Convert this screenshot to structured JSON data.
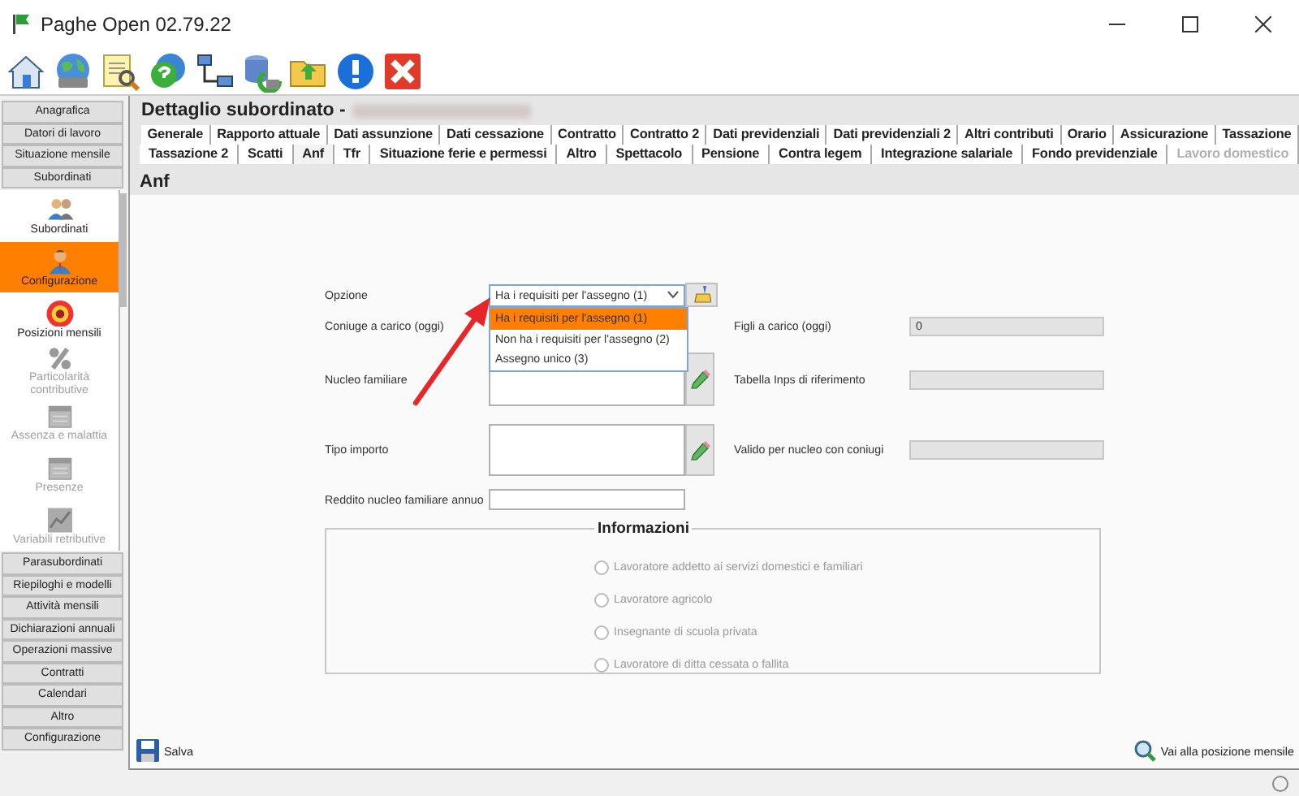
{
  "window": {
    "title": "Paghe Open 02.79.22"
  },
  "sidebar": {
    "top_items": [
      {
        "label": "Anagrafica"
      },
      {
        "label": "Datori di lavoro"
      },
      {
        "label": "Situazione mensile"
      },
      {
        "label": "Subordinati"
      }
    ],
    "items": [
      {
        "label": "Subordinati",
        "selected": false,
        "disabled": false
      },
      {
        "label": "Configurazione",
        "selected": true,
        "disabled": false
      },
      {
        "label": "Posizioni mensili",
        "selected": false,
        "disabled": false
      },
      {
        "label": "Particolarità contributive",
        "selected": false,
        "disabled": true
      },
      {
        "label": "Assenza e malattia",
        "selected": false,
        "disabled": true
      },
      {
        "label": "Presenze",
        "selected": false,
        "disabled": true
      },
      {
        "label": "Variabili retributive",
        "selected": false,
        "disabled": true
      }
    ],
    "bottom_items": [
      {
        "label": "Parasubordinati"
      },
      {
        "label": "Riepiloghi e modelli"
      },
      {
        "label": "Attività mensili"
      },
      {
        "label": "Dichiarazioni annuali"
      },
      {
        "label": "Operazioni massive"
      },
      {
        "label": "Contratti"
      },
      {
        "label": "Calendari"
      },
      {
        "label": "Altro"
      },
      {
        "label": "Configurazione"
      }
    ]
  },
  "header": {
    "title": "Dettaglio subordinato -"
  },
  "tab_rows": [
    [
      {
        "label": "Generale",
        "selected": false,
        "disabled": false
      },
      {
        "label": "Rapporto attuale",
        "selected": false,
        "disabled": false
      },
      {
        "label": "Dati assunzione",
        "selected": false,
        "disabled": false
      },
      {
        "label": "Dati cessazione",
        "selected": false,
        "disabled": false
      },
      {
        "label": "Contratto",
        "selected": false,
        "disabled": false
      },
      {
        "label": "Contratto 2",
        "selected": false,
        "disabled": false
      },
      {
        "label": "Dati previdenziali",
        "selected": false,
        "disabled": false
      },
      {
        "label": "Dati previdenziali 2",
        "selected": false,
        "disabled": false
      },
      {
        "label": "Altri contributi",
        "selected": false,
        "disabled": false
      },
      {
        "label": "Orario",
        "selected": false,
        "disabled": false
      },
      {
        "label": "Assicurazione",
        "selected": false,
        "disabled": false
      },
      {
        "label": "Tassazione",
        "selected": false,
        "disabled": false
      }
    ],
    [
      {
        "label": "Tassazione 2",
        "selected": false,
        "disabled": false
      },
      {
        "label": "Scatti",
        "selected": false,
        "disabled": false
      },
      {
        "label": "Anf",
        "selected": true,
        "disabled": false
      },
      {
        "label": "Tfr",
        "selected": false,
        "disabled": false
      },
      {
        "label": "Situazione ferie e permessi",
        "selected": false,
        "disabled": false
      },
      {
        "label": "Altro",
        "selected": false,
        "disabled": false
      },
      {
        "label": "Spettacolo",
        "selected": false,
        "disabled": false
      },
      {
        "label": "Pensione",
        "selected": false,
        "disabled": false
      },
      {
        "label": "Contra legem",
        "selected": false,
        "disabled": false
      },
      {
        "label": "Integrazione salariale",
        "selected": false,
        "disabled": false
      },
      {
        "label": "Fondo previdenziale",
        "selected": false,
        "disabled": false
      },
      {
        "label": "Lavoro domestico",
        "selected": false,
        "disabled": true
      }
    ]
  ],
  "section": {
    "title": "Anf"
  },
  "form": {
    "opzione": {
      "label": "Opzione",
      "value": "Ha i requisiti per l'assegno (1)",
      "expanded": true,
      "options": [
        {
          "label": "Ha i requisiti per l'assegno (1)",
          "selected": true
        },
        {
          "label": "Non ha i requisiti per l'assegno (2)",
          "selected": false
        },
        {
          "label": "Assegno unico (3)",
          "selected": false
        }
      ]
    },
    "coniuge": {
      "label": "Coniuge a carico (oggi)"
    },
    "nucleo": {
      "label": "Nucleo familiare"
    },
    "tipo_importo": {
      "label": "Tipo importo"
    },
    "reddito": {
      "label": "Reddito nucleo familiare annuo"
    },
    "figli": {
      "label": "Figli a carico (oggi)",
      "value": "0"
    },
    "tabella": {
      "label": "Tabella Inps di riferimento"
    },
    "valido": {
      "label": "Valido per nucleo con coniugi"
    }
  },
  "informazioni": {
    "title": "Informazioni",
    "options": [
      {
        "label": "Lavoratore addetto ai servizi domestici e familiari",
        "selected": false,
        "disabled": true
      },
      {
        "label": "Lavoratore agricolo",
        "selected": false,
        "disabled": true
      },
      {
        "label": "Insegnante di scuola privata",
        "selected": false,
        "disabled": true
      },
      {
        "label": "Lavoratore di ditta cessata o fallita",
        "selected": false,
        "disabled": true
      }
    ]
  },
  "footer": {
    "save": "Salva",
    "goto": "Vai alla posizione mensile"
  }
}
